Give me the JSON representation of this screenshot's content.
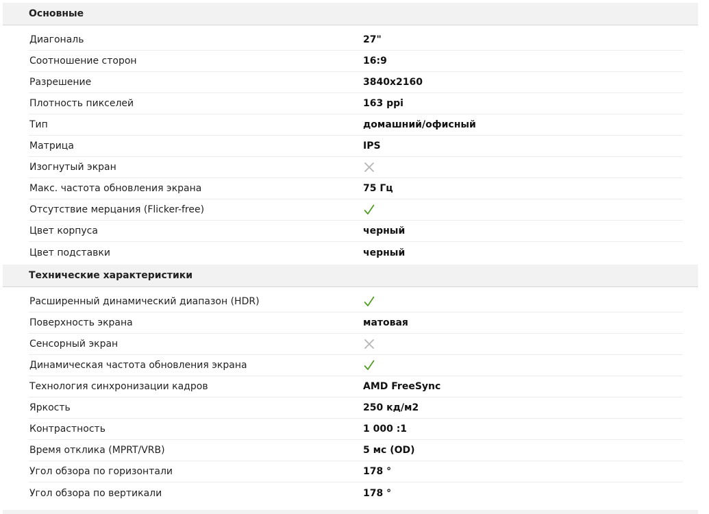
{
  "sections": [
    {
      "title": "Основные",
      "rows": [
        {
          "label": "Диагональ",
          "value": "27\""
        },
        {
          "label": "Соотношение сторон",
          "value": "16:9"
        },
        {
          "label": "Разрешение",
          "value": "3840x2160"
        },
        {
          "label": "Плотность пикселей",
          "value": "163 ppi"
        },
        {
          "label": "Тип",
          "value": "домашний/офисный"
        },
        {
          "label": "Матрица",
          "value": "IPS"
        },
        {
          "label": "Изогнутый экран",
          "icon": "cross-icon"
        },
        {
          "label": "Макс. частота обновления экрана",
          "value": "75 Гц"
        },
        {
          "label": "Отсутствие мерцания (Flicker-free)",
          "icon": "check-icon"
        },
        {
          "label": "Цвет корпуса",
          "value": "черный"
        },
        {
          "label": "Цвет подставки",
          "value": "черный"
        }
      ]
    },
    {
      "title": "Технические характеристики",
      "rows": [
        {
          "label": "Расширенный динамический диапазон (HDR)",
          "icon": "check-icon"
        },
        {
          "label": "Поверхность экрана",
          "value": "матовая"
        },
        {
          "label": "Сенсорный экран",
          "icon": "cross-icon"
        },
        {
          "label": "Динамическая частота обновления экрана",
          "icon": "check-icon"
        },
        {
          "label": "Технология синхронизации кадров",
          "value": "AMD FreeSync"
        },
        {
          "label": "Яркость",
          "value": "250 кд/м2"
        },
        {
          "label": "Контрастность",
          "value": "1 000 :1"
        },
        {
          "label": "Время отклика (MPRT/VRB)",
          "value": "5 мс (OD)"
        },
        {
          "label": "Угол обзора по горизонтали",
          "value": "178 °"
        },
        {
          "label": "Угол обзора по вертикали",
          "value": "178 °"
        }
      ]
    }
  ],
  "colors": {
    "check": "#4a9a1c",
    "cross": "#b5b5b5",
    "header_bg": "#f2f2f2"
  }
}
